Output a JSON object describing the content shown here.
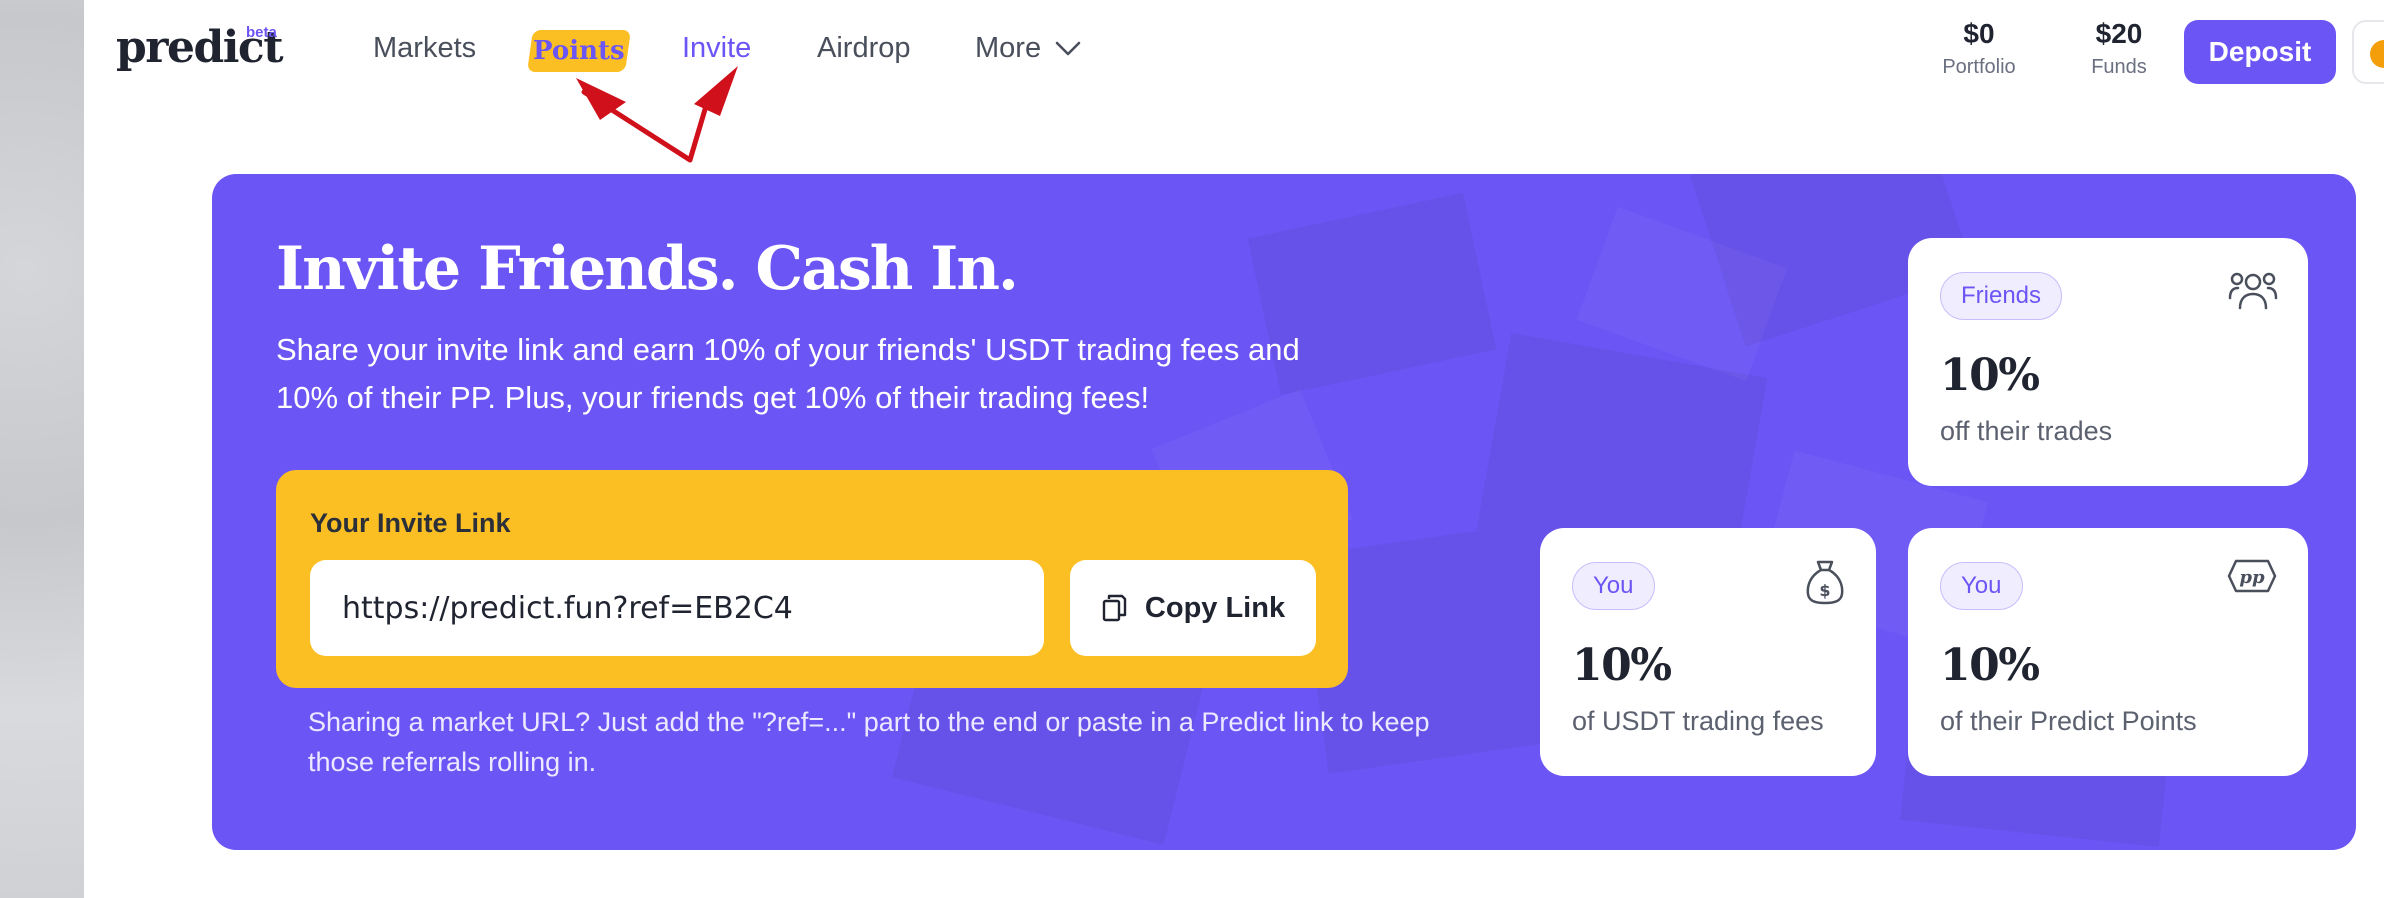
{
  "brand": {
    "logo": "predict",
    "badge": "beta"
  },
  "nav": {
    "markets": "Markets",
    "points": "Points",
    "invite": "Invite",
    "airdrop": "Airdrop",
    "more": "More"
  },
  "account": {
    "portfolio_value": "$0",
    "portfolio_label": "Portfolio",
    "funds_value": "$20",
    "funds_label": "Funds",
    "deposit_label": "Deposit"
  },
  "hero": {
    "title": "Invite Friends. Cash In.",
    "description": "Share your invite link and earn 10% of your friends' USDT trading fees and 10% of their PP. Plus, your friends get 10% of their trading fees!",
    "invite_label": "Your Invite Link",
    "invite_link": "https://predict.fun?ref=EB2C4",
    "copy_label": "Copy Link",
    "hint": "Sharing a market URL? Just add the \"?ref=...\" part to the end or paste in a Predict link to keep those referrals rolling in."
  },
  "rewards": [
    {
      "tag": "Friends",
      "value": "10%",
      "text": "off their trades",
      "icon": "users-icon"
    },
    {
      "tag": "You",
      "value": "10%",
      "text": "of USDT trading fees",
      "icon": "money-bag-icon"
    },
    {
      "tag": "You",
      "value": "10%",
      "text": "of their Predict Points",
      "icon": "predict-points-icon"
    }
  ],
  "colors": {
    "accent": "#6c55f5",
    "highlight": "#fbbf24",
    "annotation_arrow": "#d0101a"
  }
}
